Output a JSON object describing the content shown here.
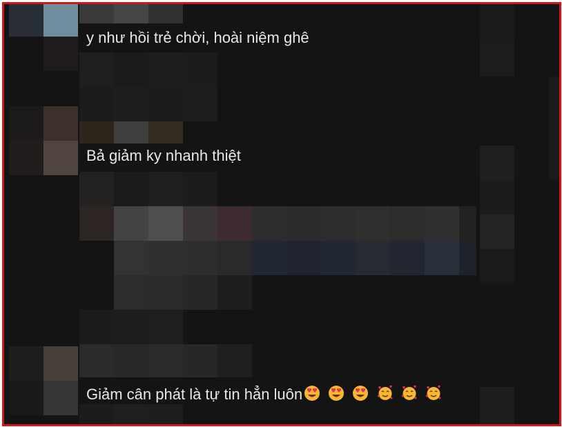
{
  "comments": [
    {
      "text": "y như hồi trẻ chời, hoài niệm ghê"
    },
    {
      "text": "Bả giảm ky nhanh thiệt"
    },
    {
      "text": "Giảm cân phát là tự tin hẳn luôn"
    }
  ],
  "reactions": {
    "emojis": [
      "heart-eyes-emoji",
      "heart-eyes-emoji",
      "heart-eyes-emoji",
      "smiling-face-with-hearts-emoji",
      "smiling-face-with-hearts-emoji",
      "smiling-face-with-hearts-emoji"
    ]
  },
  "colors": {
    "border": "#d01818",
    "background": "#141414",
    "text": "#e8e8e8",
    "emoji_face": "#f7b731",
    "emoji_heart": "#e8305a"
  }
}
